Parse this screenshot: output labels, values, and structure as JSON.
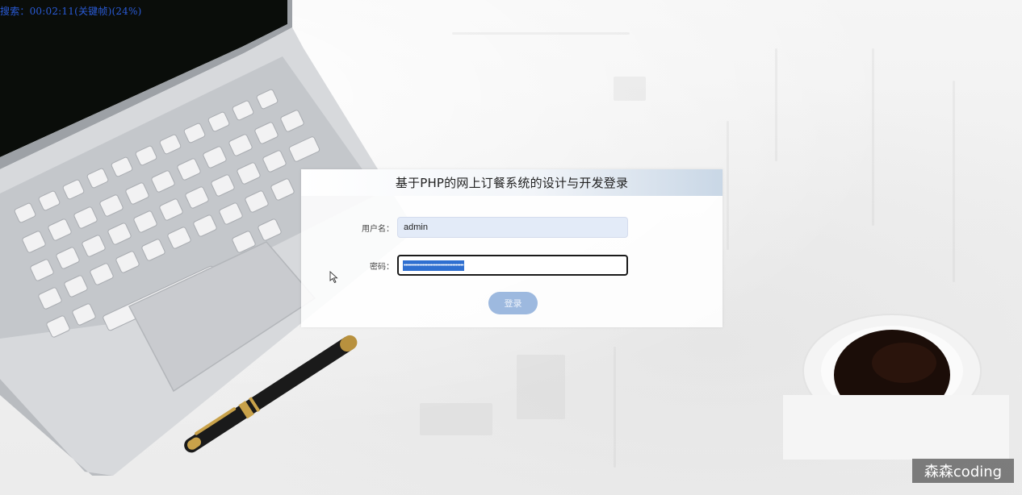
{
  "overlay": {
    "status_text": "搜索：00:02:11(关键帧)(24%)"
  },
  "login": {
    "title": "基于PHP的网上订餐系统的设计与开发登录",
    "username_label": "用户名：",
    "username_value": "admin",
    "password_label": "密码：",
    "password_masked": "••••••••••••••••••••••••••••••••••••••",
    "submit_label": "登录"
  },
  "watermark": {
    "text": "森森coding"
  },
  "colors": {
    "accent": "#2f6fd0",
    "button": "#9db9df",
    "input_fill": "#e3ebf8",
    "overlay_text": "#2a5bd7"
  },
  "icons": {
    "cursor": "mouse-pointer-icon"
  }
}
